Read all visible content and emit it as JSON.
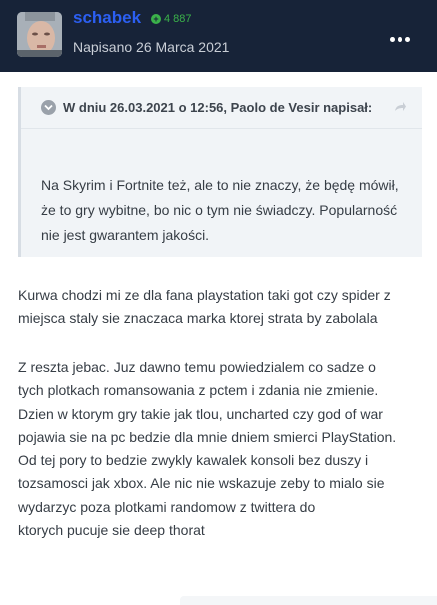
{
  "post": {
    "author": "schabek",
    "reputation": "4 887",
    "posted_date": "Napisano 26 Marca 2021",
    "menu_icon": "more-horizontal-icon"
  },
  "quote": {
    "header": "W dniu 26.03.2021 o 12:56, Paolo de Vesir napisał:",
    "text": "Na Skyrim i Fortnite też, ale to nie znaczy, że będę mówił, że to gry wybitne, bo nic o tym nie świadczy. Popularność nie jest gwarantem jakości."
  },
  "content": {
    "paragraph_1": "Kurwa chodzi mi ze dla fana playstation taki got czy spider z miejsca staly sie znaczaca marka ktorej strata by zabolala",
    "paragraph_2_lines": [
      "Z reszta jebac. Juz dawno temu powiedzialem co sadze o",
      "tych plotkach romansowania z pctem i zdania nie zmienie.",
      "Dzien w ktorym gry takie jak tlou, uncharted czy god of war",
      "pojawia sie na pc bedzie dla mnie dniem smierci PlayStation.",
      "Od tej pory to bedzie zwykly kawalek konsoli bez duszy i",
      "tozsamosci jak xbox. Ale nic nie wskazuje zeby to mialo sie",
      "wydarzyc poza plotkami randomow z twittera do",
      "ktorych pucuje sie deep thorat"
    ]
  },
  "colors": {
    "header_bg": "#172338",
    "username": "#2c5ff2",
    "reputation": "#3bb24a",
    "quote_bg": "#f1f4f7"
  }
}
